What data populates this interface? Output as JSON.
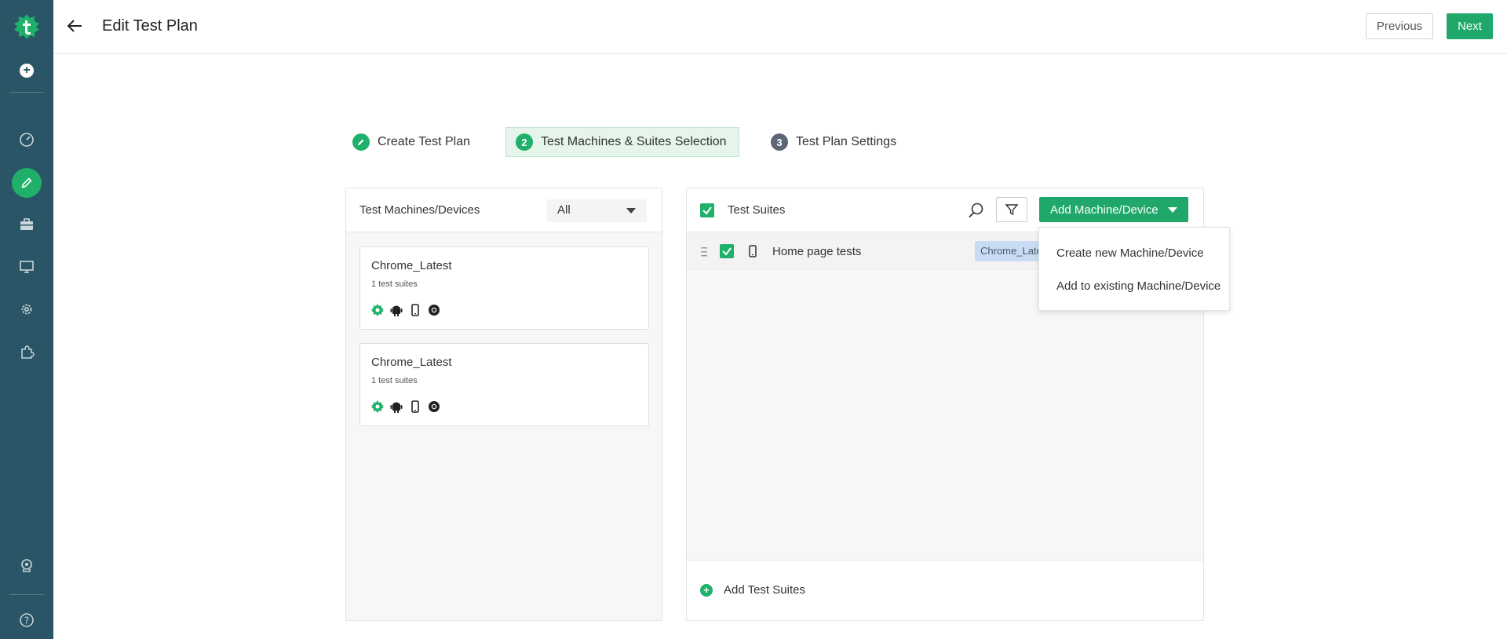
{
  "colors": {
    "sidebar_bg": "#2a5566",
    "accent_green": "#1fa86a",
    "step_active_bg": "#e5f5ec",
    "tag_bg": "#c9dcf3"
  },
  "sidebar": {
    "logo": "testsigma-logo-icon",
    "items": [
      {
        "icon": "plus-circle-icon"
      },
      {
        "icon": "dashboard-gauge-icon"
      },
      {
        "icon": "pencil-icon",
        "active": true
      },
      {
        "icon": "briefcase-icon"
      },
      {
        "icon": "monitor-icon"
      },
      {
        "icon": "settings-gear-icon"
      },
      {
        "icon": "puzzle-icon"
      },
      {
        "icon": "help-bot-icon"
      },
      {
        "icon": "question-icon"
      }
    ]
  },
  "header": {
    "title": "Edit Test Plan",
    "previous_label": "Previous",
    "next_label": "Next"
  },
  "stepper": {
    "steps": [
      {
        "number": "",
        "label": "Create Test Plan",
        "state": "done"
      },
      {
        "number": "2",
        "label": "Test Machines & Suites Selection",
        "state": "active"
      },
      {
        "number": "3",
        "label": "Test Plan Settings",
        "state": "pending"
      }
    ]
  },
  "machines_panel": {
    "title": "Test Machines/Devices",
    "filter_value": "All",
    "machines": [
      {
        "name": "Chrome_Latest",
        "suites": "1 test suites"
      },
      {
        "name": "Chrome_Latest",
        "suites": "1 test suites"
      }
    ]
  },
  "suites_panel": {
    "title": "Test Suites",
    "add_button_label": "Add Machine/Device",
    "rows": [
      {
        "name": "Home page tests",
        "tag": "Chrome_Latest"
      }
    ],
    "add_suites_label": "Add Test Suites"
  },
  "dropdown": {
    "items": [
      "Create new Machine/Device",
      "Add to existing Machine/Device"
    ]
  }
}
